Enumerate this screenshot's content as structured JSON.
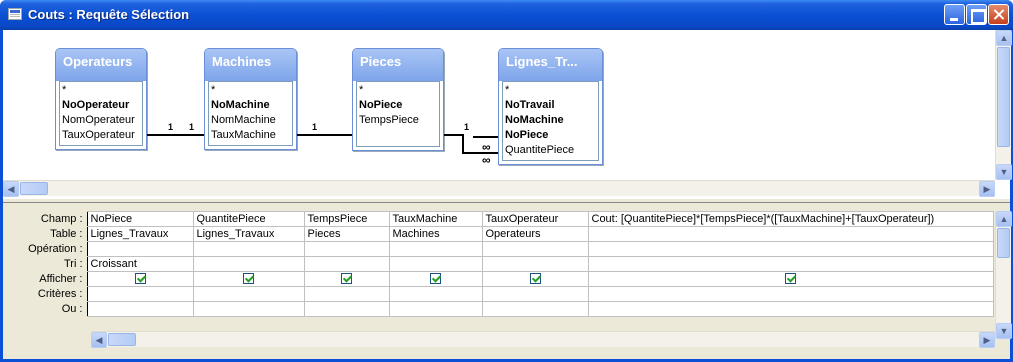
{
  "window": {
    "title": "Couts : Requête Sélection"
  },
  "tables": [
    {
      "name": "Operateurs",
      "fields": [
        {
          "label": "*",
          "key": false
        },
        {
          "label": "NoOperateur",
          "key": true
        },
        {
          "label": "NomOperateur",
          "key": false
        },
        {
          "label": "TauxOperateur",
          "key": false
        }
      ]
    },
    {
      "name": "Machines",
      "fields": [
        {
          "label": "*",
          "key": false
        },
        {
          "label": "NoMachine",
          "key": true
        },
        {
          "label": "NomMachine",
          "key": false
        },
        {
          "label": "TauxMachine",
          "key": false
        }
      ]
    },
    {
      "name": "Pieces",
      "fields": [
        {
          "label": "*",
          "key": false
        },
        {
          "label": "NoPiece",
          "key": true
        },
        {
          "label": "TempsPiece",
          "key": false
        }
      ]
    },
    {
      "name": "Lignes_Tr...",
      "fields": [
        {
          "label": "*",
          "key": false
        },
        {
          "label": "NoTravail",
          "key": true
        },
        {
          "label": "NoMachine",
          "key": true
        },
        {
          "label": "NoPiece",
          "key": true
        },
        {
          "label": "QuantitePiece",
          "key": false
        }
      ]
    }
  ],
  "relations": {
    "one": "1",
    "many": "∞"
  },
  "grid": {
    "row_headers": [
      "Champ :",
      "Table :",
      "Opération :",
      "Tri :",
      "Afficher :",
      "Critères :",
      "Ou :"
    ],
    "columns": [
      {
        "champ": "NoPiece",
        "table": "Lignes_Travaux",
        "operation": "",
        "tri": "Croissant",
        "afficher": true
      },
      {
        "champ": "QuantitePiece",
        "table": "Lignes_Travaux",
        "operation": "",
        "tri": "",
        "afficher": true
      },
      {
        "champ": "TempsPiece",
        "table": "Pieces",
        "operation": "",
        "tri": "",
        "afficher": true
      },
      {
        "champ": "TauxMachine",
        "table": "Machines",
        "operation": "",
        "tri": "",
        "afficher": true
      },
      {
        "champ": "TauxOperateur",
        "table": "Operateurs",
        "operation": "",
        "tri": "",
        "afficher": true
      },
      {
        "champ": "Cout: [QuantitePiece]*[TempsPiece]*([TauxMachine]+[TauxOperateur])",
        "table": "",
        "operation": "",
        "tri": "",
        "afficher": true
      }
    ]
  }
}
